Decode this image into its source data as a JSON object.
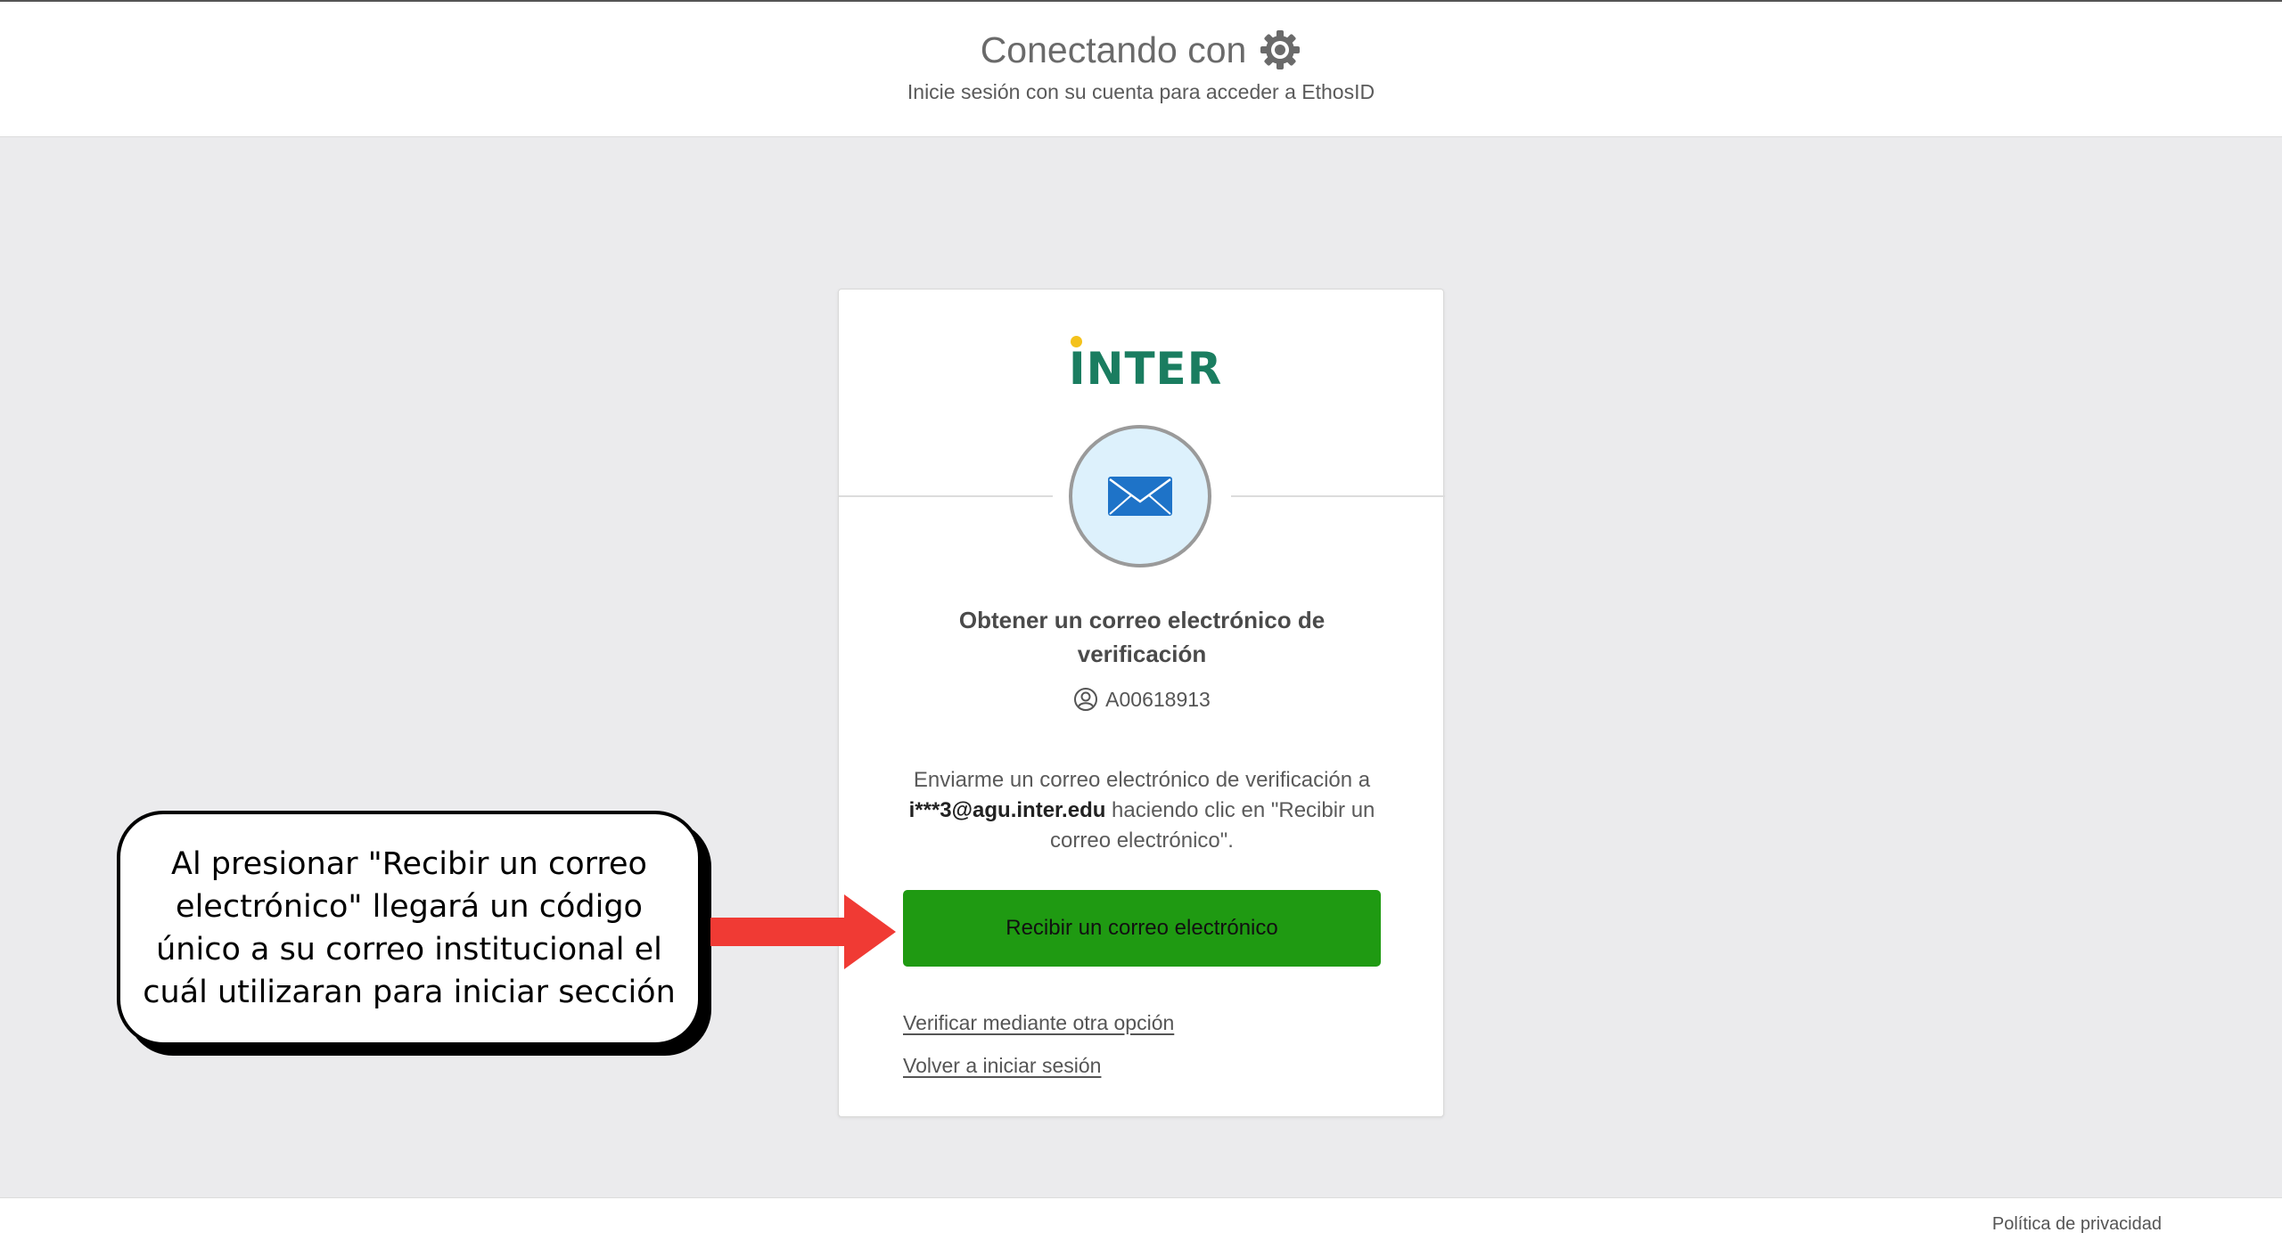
{
  "header": {
    "title": "Conectando con",
    "subtitle": "Inicie sesión con su cuenta para acceder a EthosID"
  },
  "card": {
    "logo_text": "INTER",
    "title": "Obtener un correo electrónico de verificación",
    "user_id": "A00618913",
    "description_pre": "Enviarme un correo electrónico de verificación a ",
    "email": "i***3@agu.inter.edu",
    "description_post": " haciendo clic en \"Recibir un correo electrónico\".",
    "send_button": "Recibir un correo electrónico",
    "link_other_option": "Verificar mediante otra opción",
    "link_back": "Volver a iniciar sesión"
  },
  "footer": {
    "privacy_link": "Política de privacidad"
  },
  "annotation": {
    "callout_text": "Al presionar \"Recibir un correo electrónico\" llegará un código único a su correo institucional el cuál utilizaran para iniciar sección"
  },
  "colors": {
    "accent_green": "#1f9a12",
    "logo_green": "#1a7d60",
    "arrow_red": "#f03a34",
    "mail_bg": "#ddf1fc",
    "mail_icon": "#1e73c8"
  },
  "icons": {
    "header": "gear-icon",
    "mail": "envelope-icon",
    "user": "user-circle-icon",
    "callout": "arrow-right-icon"
  }
}
